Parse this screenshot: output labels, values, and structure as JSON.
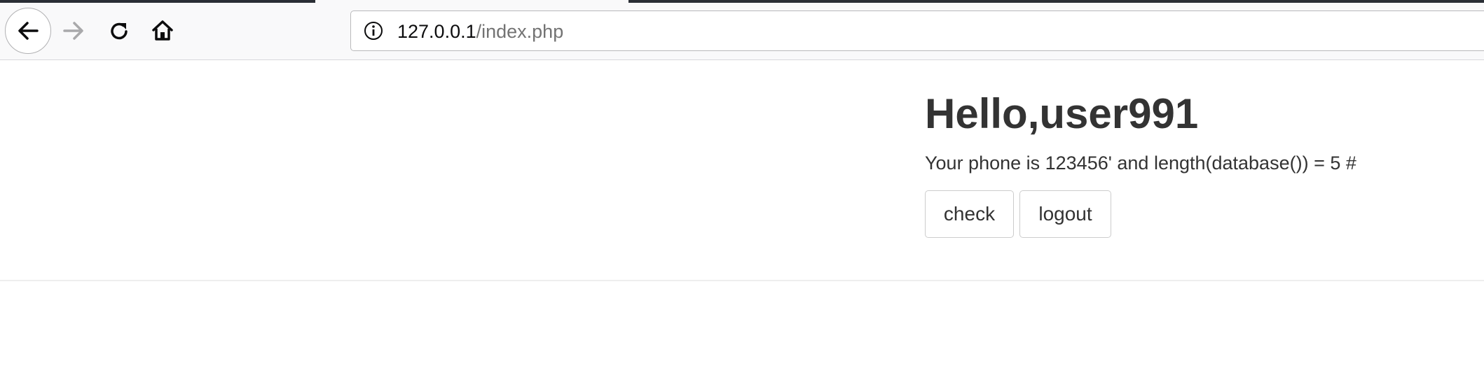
{
  "browser": {
    "url_host": "127.0.0.1",
    "url_path": "/index.php",
    "icons": {
      "back": "back-arrow-icon",
      "forward": "forward-arrow-icon",
      "reload": "reload-icon",
      "home": "home-icon",
      "site_info": "info-icon"
    }
  },
  "page": {
    "greeting": "Hello,user991",
    "phone_text": "Your phone is 123456' and length(database()) = 5 #",
    "check_label": "check",
    "logout_label": "logout"
  }
}
